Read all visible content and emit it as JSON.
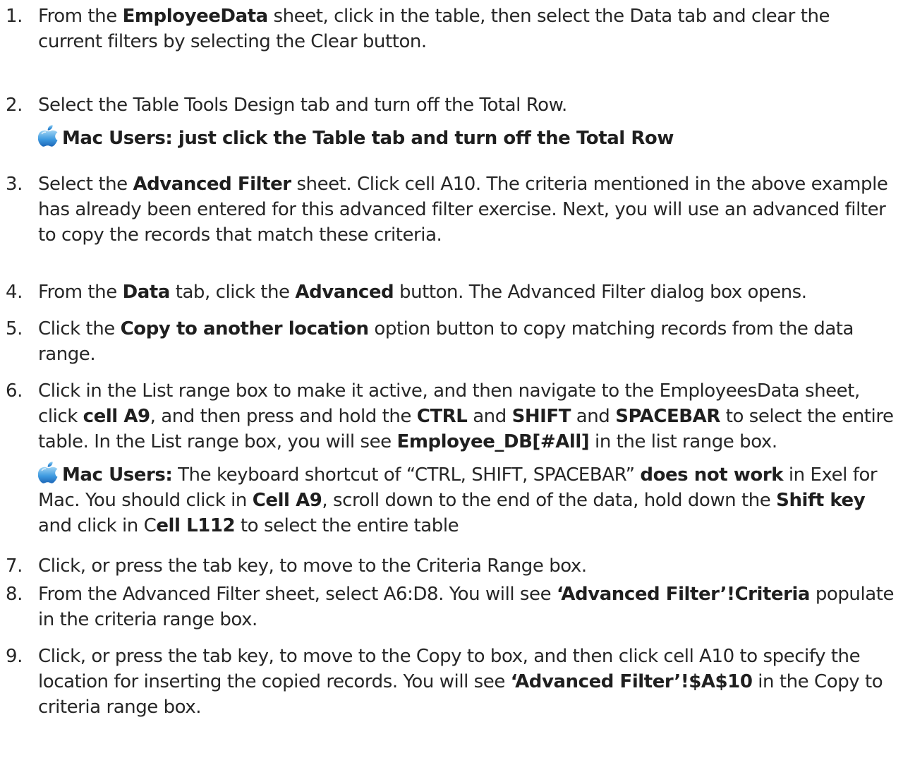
{
  "steps": [
    {
      "num": "1.",
      "runs": [
        {
          "t": "From the "
        },
        {
          "t": "EmployeeData",
          "b": true
        },
        {
          "t": " sheet, click in the table, then select the Data tab and clear the current filters by selecting the Clear button."
        }
      ]
    },
    {
      "num": "2.",
      "runs": [
        {
          "t": "Select the Table Tools Design tab and turn off the Total Row."
        }
      ],
      "mac_note": {
        "icon": "apple-icon",
        "heading": true,
        "runs": [
          {
            "t": "Mac Users: just click the Table tab and turn off the Total Row",
            "b": true
          }
        ]
      }
    },
    {
      "num": "3.",
      "runs": [
        {
          "t": "Select the "
        },
        {
          "t": "Advanced Filter",
          "b": true
        },
        {
          "t": " sheet. Click cell A10. The criteria mentioned in the above example has already been entered for this advanced filter exercise.  Next, you will use an advanced filter to copy the records that match these criteria."
        }
      ]
    },
    {
      "num": "4.",
      "runs": [
        {
          "t": "From the "
        },
        {
          "t": "Data",
          "b": true
        },
        {
          "t": " tab, click the "
        },
        {
          "t": "Advanced",
          "b": true
        },
        {
          "t": " button. The Advanced Filter dialog box opens."
        }
      ]
    },
    {
      "num": "5.",
      "runs": [
        {
          "t": "Click the "
        },
        {
          "t": "Copy to another location",
          "b": true
        },
        {
          "t": " option button to copy matching records from the data range."
        }
      ]
    },
    {
      "num": "6.",
      "runs": [
        {
          "t": "Click in the List range box to make it active, and then navigate to the EmployeesData sheet, click "
        },
        {
          "t": "cell A9",
          "b": true
        },
        {
          "t": ", and then press and hold the "
        },
        {
          "t": "CTRL",
          "b": true
        },
        {
          "t": " and "
        },
        {
          "t": "SHIFT",
          "b": true
        },
        {
          "t": " and "
        },
        {
          "t": "SPACEBAR",
          "b": true
        },
        {
          "t": " to select the entire table. In the List range box, you will see "
        },
        {
          "t": "Employee_DB[#All]",
          "b": true
        },
        {
          "t": " in the list range box."
        }
      ],
      "mac_note": {
        "icon": "apple-icon",
        "heading": false,
        "runs": [
          {
            "t": "Mac Users:",
            "b": true
          },
          {
            "t": " The keyboard shortcut of “CTRL, SHIFT, SPACEBAR” "
          },
          {
            "t": "does not work",
            "b": true
          },
          {
            "t": " in Exel for Mac. You should click in "
          },
          {
            "t": "Cell A9",
            "b": true
          },
          {
            "t": ", scroll down to the end of the data, hold down the "
          },
          {
            "t": "Shift key",
            "b": true
          },
          {
            "t": " and click in C"
          },
          {
            "t": "ell L112",
            "b": true
          },
          {
            "t": " to select the entire table"
          }
        ]
      }
    },
    {
      "num": "7.",
      "runs": [
        {
          "t": "Click, or press the tab key, to move to the Criteria Range box."
        }
      ]
    },
    {
      "num": "8.",
      "runs": [
        {
          "t": "From the Advanced Filter sheet, select A6:D8. You will see "
        },
        {
          "t": "‘Advanced Filter’!Criteria",
          "b": true
        },
        {
          "t": " populate in the criteria range box."
        }
      ]
    },
    {
      "num": "9.",
      "runs": [
        {
          "t": "Click, or press the tab key, to move to the Copy to box, and then click cell A10 to specify the location for inserting the copied records. You will see "
        },
        {
          "t": "‘Advanced Filter’!$A$10",
          "b": true
        },
        {
          "t": " in the Copy to criteria range box."
        }
      ]
    }
  ]
}
